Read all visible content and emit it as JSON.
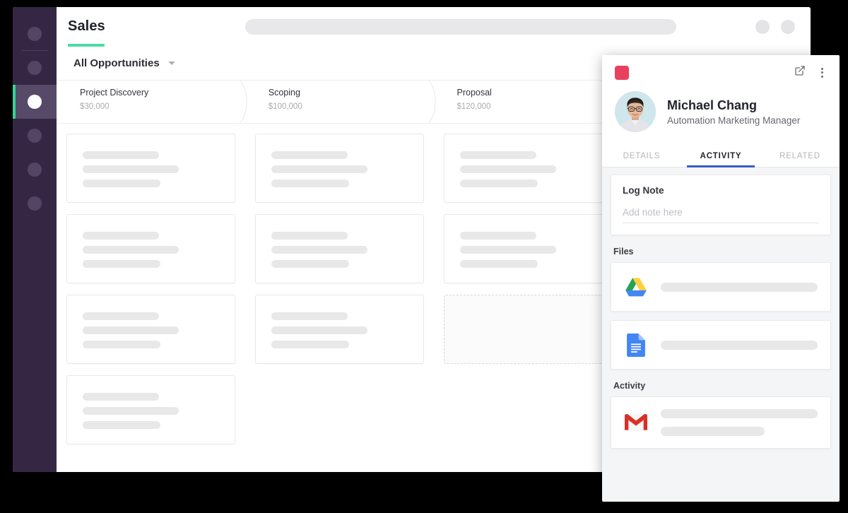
{
  "app": {
    "title": "Sales",
    "search_placeholder": "",
    "accent_green": "#4bdca4",
    "sidebar_bg": "#352744"
  },
  "filter": {
    "label": "All Opportunities",
    "caret_icon": "chevron-down-icon"
  },
  "sidebar": {
    "items": [
      {
        "name": "sidebar-item-1",
        "icon": "circle-icon",
        "active": false
      },
      {
        "name": "sidebar-item-2",
        "icon": "circle-icon",
        "active": false
      },
      {
        "name": "sidebar-item-3",
        "icon": "circle-icon",
        "active": true
      },
      {
        "name": "sidebar-item-4",
        "icon": "circle-icon",
        "active": false
      },
      {
        "name": "sidebar-item-5",
        "icon": "circle-icon",
        "active": false
      },
      {
        "name": "sidebar-item-6",
        "icon": "circle-icon",
        "active": false
      }
    ]
  },
  "topbar": {
    "circle_buttons": [
      "avatar-circle",
      "notification-circle"
    ]
  },
  "pipeline": {
    "stages": [
      {
        "name": "Project Discovery",
        "amount": "$30,000",
        "cards": 4
      },
      {
        "name": "Scoping",
        "amount": "$100,000",
        "cards": 3
      },
      {
        "name": "Proposal",
        "amount": "$120,000",
        "cards": 2,
        "ghost": true
      },
      {
        "name": "",
        "amount": "",
        "cards": 0
      }
    ]
  },
  "panel": {
    "logo_icon": "crescent-logo-icon",
    "logo_color": "#e8415e",
    "open_in_new_icon": "external-link-icon",
    "more_icon": "kebab-menu-icon",
    "person": {
      "name": "Michael Chang",
      "role": "Automation Marketing Manager",
      "avatar": "person-photo"
    },
    "tabs": [
      {
        "label": "DETAILS",
        "active": false
      },
      {
        "label": "ACTIVITY",
        "active": true
      },
      {
        "label": "RELATED",
        "active": false
      }
    ],
    "tab_accent": "#3c5bc4",
    "log_note": {
      "title": "Log Note",
      "placeholder": "Add note here",
      "value": ""
    },
    "files": {
      "title": "Files",
      "items": [
        {
          "icon": "google-drive-icon"
        },
        {
          "icon": "google-docs-icon"
        }
      ]
    },
    "activity": {
      "title": "Activity",
      "items": [
        {
          "icon": "gmail-icon"
        }
      ]
    }
  }
}
